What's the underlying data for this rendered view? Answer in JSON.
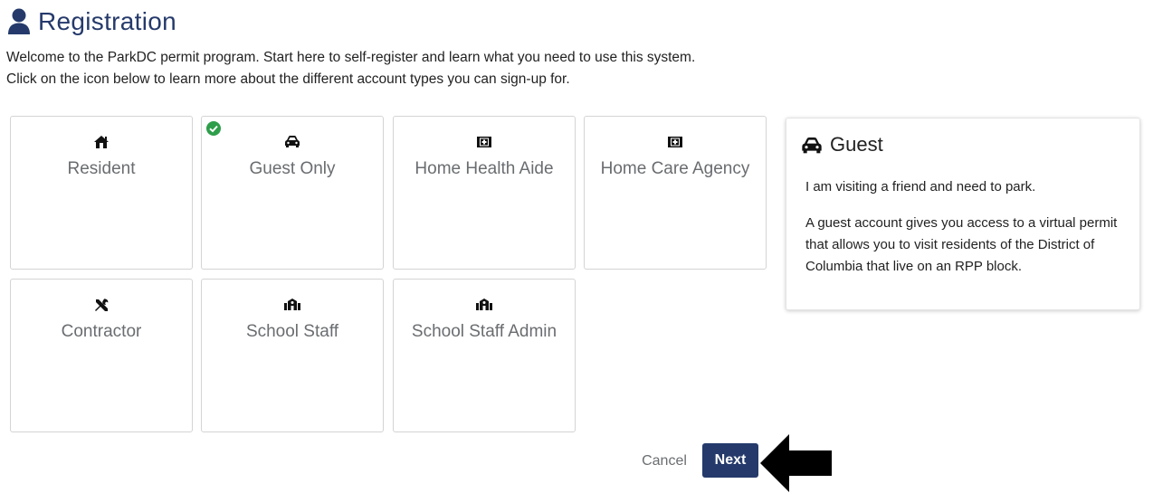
{
  "header": {
    "title": "Registration",
    "icon": "user-icon",
    "color": "#253a6b"
  },
  "intro": {
    "line1": "Welcome to the ParkDC permit program. Start here to self-register and learn what you need to use this system.",
    "line2": "Click on the icon below to learn more about the different account types you can sign-up for."
  },
  "account_types": [
    {
      "label": "Resident",
      "icon": "house-icon",
      "selected": false
    },
    {
      "label": "Guest Only",
      "icon": "car-icon",
      "selected": true
    },
    {
      "label": "Home Health Aide",
      "icon": "medical-kit-icon",
      "selected": false
    },
    {
      "label": "Home Care Agency",
      "icon": "medical-kit-icon",
      "selected": false
    },
    {
      "label": "Contractor",
      "icon": "tools-icon",
      "selected": false
    },
    {
      "label": "School Staff",
      "icon": "school-icon",
      "selected": false
    },
    {
      "label": "School Staff Admin",
      "icon": "school-icon",
      "selected": false
    }
  ],
  "selected_check": {
    "icon": "check-circle-icon",
    "color": "#2e9e4a"
  },
  "info_panel": {
    "icon": "car-icon",
    "title": "Guest",
    "paragraph1": "I am visiting a friend and need to park.",
    "paragraph2": "A guest account gives you access to a virtual permit that allows you to visit residents of the District of Columbia that live on an RPP block."
  },
  "actions": {
    "cancel_label": "Cancel",
    "next_label": "Next"
  },
  "annotation": {
    "icon": "arrow-left-icon"
  }
}
